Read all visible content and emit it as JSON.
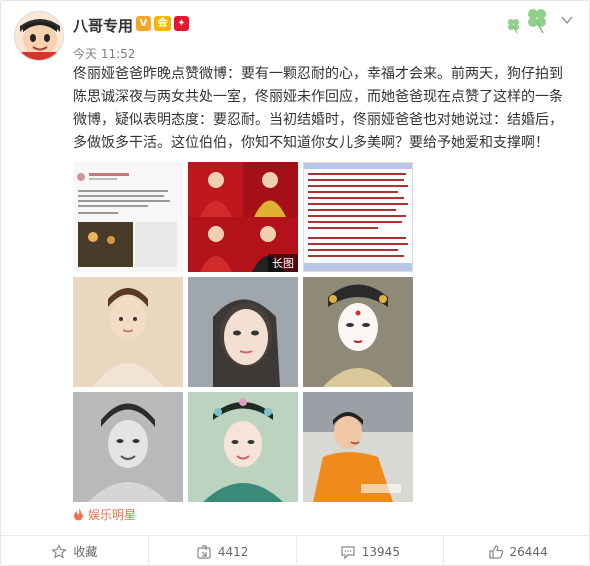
{
  "user": {
    "name": "八哥专用",
    "time": "今天 11:52"
  },
  "badges": {
    "v": "V",
    "vip": "会",
    "club": "✦"
  },
  "post": {
    "text": "佟丽娅爸爸昨晚点赞微博：要有一颗忍耐的心，幸福才会来。前两天，狗仔拍到陈思诚深夜与两女共处一室，佟丽娅未作回应，而她爸爸现在点赞了这样的一条微博，疑似表明态度：要忍耐。当初结婚时，佟丽娅爸爸也对她说过：结婚后，多做饭多干活。这位伯伯，你知不知道你女儿多美啊？要给予她爱和支撑啊！"
  },
  "images": {
    "long_label": "长图"
  },
  "source": {
    "label": "娱乐明星"
  },
  "footer": {
    "favorite": "收藏",
    "repost": "4412",
    "comment": "13945",
    "like": "26444"
  },
  "colors": {
    "accent": "#eb7350",
    "text": "#333333",
    "muted": "#808080"
  }
}
